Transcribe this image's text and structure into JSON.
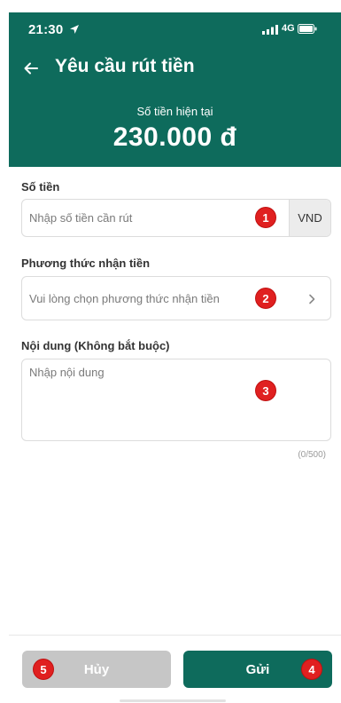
{
  "status_bar": {
    "time": "21:30",
    "network": "4G"
  },
  "header": {
    "title": "Yêu cầu rút tiền",
    "balance_label": "Số tiền hiện tại",
    "balance_value": "230.000 đ"
  },
  "amount": {
    "label": "Số tiền",
    "placeholder": "Nhập số tiền cần rút",
    "unit": "VND"
  },
  "method": {
    "label": "Phương thức nhận tiền",
    "placeholder": "Vui lòng chọn phương thức nhận tiền"
  },
  "content": {
    "label": "Nội dung (Không bắt buộc)",
    "placeholder": "Nhập nội dung",
    "counter": "(0/500)"
  },
  "buttons": {
    "cancel": "Hủy",
    "submit": "Gửi"
  },
  "markers": [
    "1",
    "2",
    "3",
    "4",
    "5"
  ],
  "colors": {
    "primary": "#0e6b5c",
    "marker": "#e02020",
    "cancel": "#c6c6c6"
  }
}
